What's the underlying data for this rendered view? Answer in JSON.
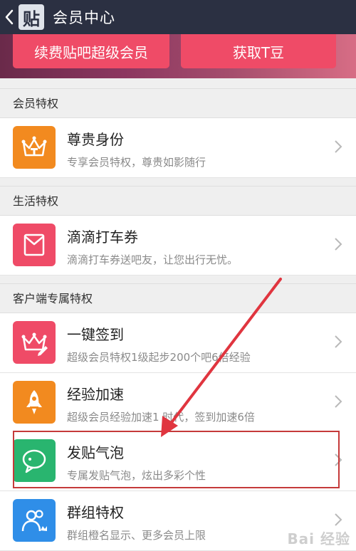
{
  "header": {
    "title": "会员中心",
    "logo_char": "贴"
  },
  "banner": {
    "renew_label": "续费贴吧超级会员",
    "get_tbean_label": "获取T豆"
  },
  "sections": [
    {
      "title": "会员特权"
    },
    {
      "title": "生活特权"
    },
    {
      "title": "客户端专属特权"
    }
  ],
  "rows": {
    "vip": {
      "title": "尊贵身份",
      "subtitle": "专享会员特权，尊贵如影随行"
    },
    "didi": {
      "title": "滴滴打车券",
      "subtitle": "滴滴打车券送吧友，让您出行无忧。"
    },
    "sign": {
      "title": "一键签到",
      "subtitle": "超级会员特权1级起步200个吧6倍经验"
    },
    "exp": {
      "title": "经验加速",
      "subtitle": "超级会员经验加速1 时代，签到加速6倍"
    },
    "bubble": {
      "title": "发贴气泡",
      "subtitle": "专属发贴气泡，炫出多彩个性"
    },
    "group": {
      "title": "群组特权",
      "subtitle": "群组橙名显示、更多会员上限"
    }
  },
  "watermark": "Bai 经验",
  "colors": {
    "header_bg": "#2b3042",
    "button_red": "#ef4b67",
    "orange_icon": "#f28a1f",
    "red_icon": "#ef4b67",
    "green_icon": "#29b56f",
    "blue_icon": "#2f8ee8",
    "annotation_red": "#c53a3a"
  },
  "icons": {
    "back": "chevron-left-icon",
    "vip": "crown-icon",
    "didi": "ticket-icon",
    "sign": "crown-pencil-icon",
    "exp": "rocket-icon",
    "bubble": "chat-bubble-icon",
    "group": "group-icon",
    "chevron": "chevron-right-icon"
  }
}
